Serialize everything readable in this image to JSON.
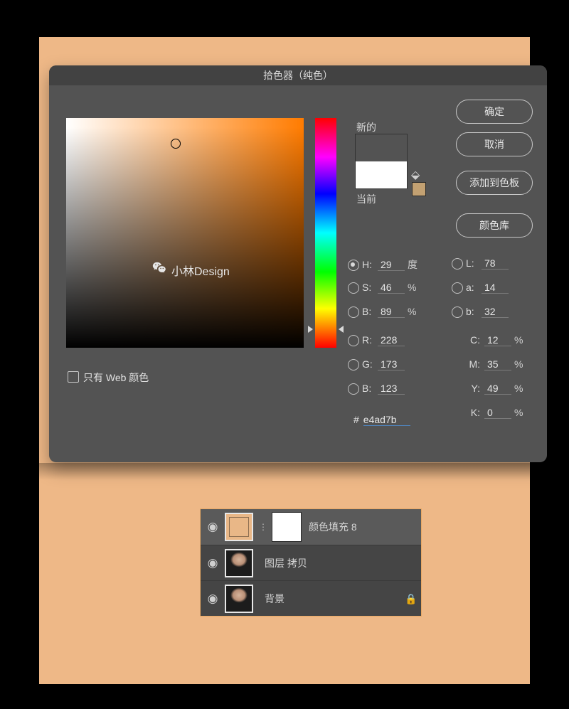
{
  "dialog": {
    "title": "拾色器（纯色）",
    "watermark": "小林Design",
    "web_only_label": "只有 Web 颜色",
    "buttons": {
      "ok": "确定",
      "cancel": "取消",
      "add_swatch": "添加到色板",
      "color_lib": "颜色库"
    },
    "swatch": {
      "new_label": "新的",
      "current_label": "当前",
      "new_color": "#e4ad7b",
      "mini_swatch": "#c3a172"
    },
    "picker": {
      "sb_x_pct": 46,
      "sb_y_pct": 11,
      "hue_pct": 92
    },
    "values": {
      "H": {
        "label": "H:",
        "val": "29",
        "unit": "度"
      },
      "S": {
        "label": "S:",
        "val": "46",
        "unit": "%"
      },
      "Bhsb": {
        "label": "B:",
        "val": "89",
        "unit": "%"
      },
      "R": {
        "label": "R:",
        "val": "228"
      },
      "G": {
        "label": "G:",
        "val": "173"
      },
      "Brgb": {
        "label": "B:",
        "val": "123"
      },
      "L": {
        "label": "L:",
        "val": "78"
      },
      "a": {
        "label": "a:",
        "val": "14"
      },
      "blab": {
        "label": "b:",
        "val": "32"
      },
      "C": {
        "label": "C:",
        "val": "12",
        "unit": "%"
      },
      "M": {
        "label": "M:",
        "val": "35",
        "unit": "%"
      },
      "Y": {
        "label": "Y:",
        "val": "49",
        "unit": "%"
      },
      "K": {
        "label": "K:",
        "val": "0",
        "unit": "%"
      },
      "hex": "e4ad7b"
    }
  },
  "layers": {
    "items": [
      {
        "name": "颜色填充 8",
        "kind": "fill",
        "locked": false,
        "selected": true
      },
      {
        "name": "图层 拷贝",
        "kind": "photo",
        "locked": false,
        "selected": false
      },
      {
        "name": "背景",
        "kind": "photo",
        "locked": true,
        "selected": false
      }
    ]
  }
}
